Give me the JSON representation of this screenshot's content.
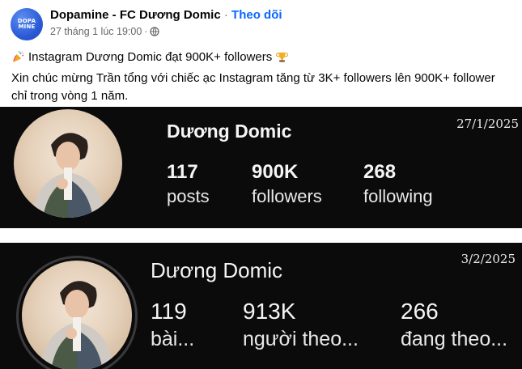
{
  "post": {
    "page_name": "Dopamine - FC Dương Domic",
    "separator": "·",
    "follow_label": "Theo dõi",
    "timestamp": "27 tháng 1 lúc 19:00",
    "dot": "·",
    "avatar_line1": "DOPA",
    "avatar_line2": "MINE",
    "headline": "Instagram Dương Domic đạt 900K+ followers",
    "caption": "Xin chúc mừng Trần tổng với chiếc ạc Instagram tăng từ 3K+ followers lên 900K+ follower chỉ trong vòng 1 năm."
  },
  "panel1": {
    "date": "27/1/2025",
    "username": "Dương Domic",
    "stats": [
      {
        "value": "117",
        "label": "posts"
      },
      {
        "value": "900K",
        "label": "followers"
      },
      {
        "value": "268",
        "label": "following"
      }
    ]
  },
  "panel2": {
    "date": "3/2/2025",
    "username": "Dương Domic",
    "stats": [
      {
        "value": "119",
        "label": "bài..."
      },
      {
        "value": "913K",
        "label": "người theo..."
      },
      {
        "value": "266",
        "label": "đang theo..."
      }
    ]
  },
  "colors": {
    "follow_blue": "#0866ff",
    "meta_gray": "#65676b",
    "panel_bg": "#0b0b0c"
  },
  "icons": {
    "globe": "globe-icon",
    "party": "party-popper-icon",
    "trophy": "trophy-icon"
  }
}
